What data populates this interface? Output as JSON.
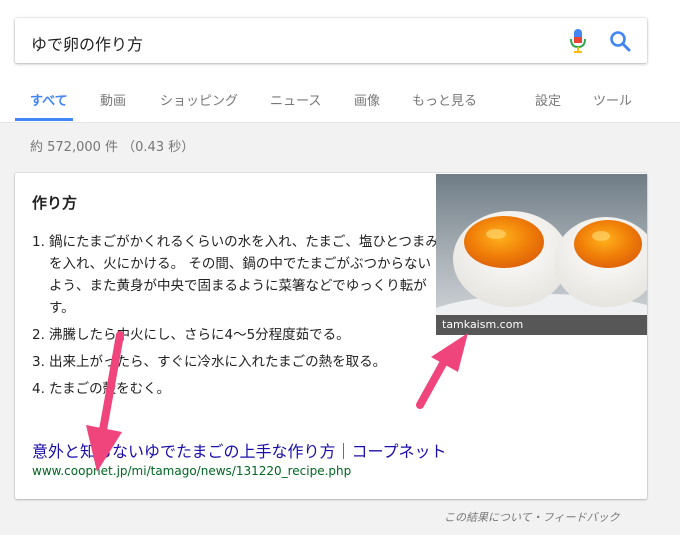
{
  "search": {
    "query": "ゆで卵の作り方"
  },
  "tabs": [
    {
      "label": "すべて",
      "active": true
    },
    {
      "label": "動画"
    },
    {
      "label": "ショッピング"
    },
    {
      "label": "ニュース"
    },
    {
      "label": "画像"
    },
    {
      "label": "もっと見る"
    },
    {
      "label": "設定"
    },
    {
      "label": "ツール"
    }
  ],
  "results_stats": "約 572,000 件 （0.43 秒）",
  "snippet": {
    "title": "作り方",
    "steps": [
      {
        "num": "1.",
        "text": "鍋にたまごがかくれるくらいの水を入れ、たまご、塩ひとつまみを入れ、火にかける。 その間、鍋の中でたまごがぶつからないよう、また黄身が中央で固まるように菜箸などでゆっくり転がす。"
      },
      {
        "num": "2.",
        "text": "沸騰したら中火にし、さらに4〜5分程度茹でる。"
      },
      {
        "num": "3.",
        "text": "出来上がったら、すぐに冷水に入れたまごの熱を取る。"
      },
      {
        "num": "4.",
        "text": "たまごの殻をむく。"
      }
    ],
    "image_caption": "tamkaism.com",
    "link_text": "意外と知らないゆでたまごの上手な作り方｜コープネット",
    "url": "www.coopnet.jp/mi/tamago/news/131220_recipe.php"
  },
  "feedback": "この結果について・フィードバック",
  "colors": {
    "accent": "#4285f4",
    "link": "#1a0dab",
    "url": "#006621",
    "annotation_arrow": "#f0457c"
  }
}
